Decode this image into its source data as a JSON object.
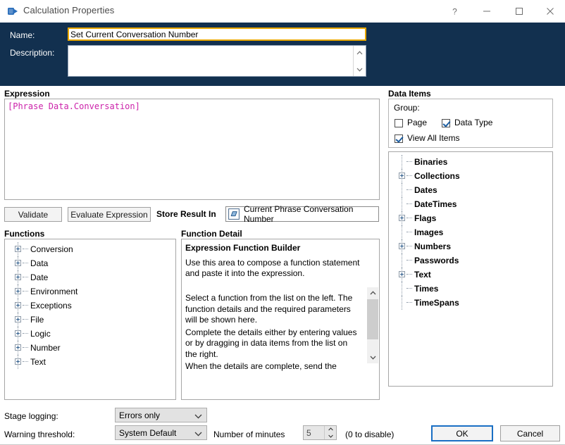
{
  "window": {
    "title": "Calculation Properties",
    "icon": "calculation-stage-icon",
    "controls": {
      "help": "?",
      "minimize": "—",
      "maximize": "□",
      "close": "✕"
    }
  },
  "header": {
    "name_label": "Name:",
    "name_value": "Set Current Conversation Number",
    "description_label": "Description:",
    "description_value": "",
    "accent_color": "#12304f",
    "name_focus_color": "#e8a600"
  },
  "expression": {
    "group_label": "Expression",
    "text": "[Phrase Data.Conversation]",
    "text_color": "#cc22aa"
  },
  "actions": {
    "validate": "Validate",
    "evaluate": "Evaluate Expression",
    "store_result_label": "Store Result In",
    "store_result_value": "Current Phrase Conversation Number",
    "store_result_icon": "number-data-item-icon"
  },
  "functions": {
    "group_label": "Functions",
    "items": [
      {
        "label": "Conversion",
        "expandable": true
      },
      {
        "label": "Data",
        "expandable": true
      },
      {
        "label": "Date",
        "expandable": true
      },
      {
        "label": "Environment",
        "expandable": true
      },
      {
        "label": "Exceptions",
        "expandable": true
      },
      {
        "label": "File",
        "expandable": true
      },
      {
        "label": "Logic",
        "expandable": true
      },
      {
        "label": "Number",
        "expandable": true
      },
      {
        "label": "Text",
        "expandable": true
      }
    ]
  },
  "function_detail": {
    "group_label": "Function Detail",
    "title": "Expression Function Builder",
    "intro": "Use this area to compose a function statement and paste it into the expression.",
    "paragraphs": [
      "Select a function from the list on the left. The function details and the required parameters will be shown here.",
      "Complete the details either by entering values or by dragging in data items from the list on the right.",
      "When the details are complete, send the"
    ]
  },
  "data_items": {
    "group_label": "Data Items",
    "group_by_label": "Group:",
    "checkboxes": [
      {
        "label": "Page",
        "checked": false
      },
      {
        "label": "Data Type",
        "checked": true
      },
      {
        "label": "View All Items",
        "checked": true
      }
    ],
    "items": [
      {
        "label": "Binaries",
        "expandable": false
      },
      {
        "label": "Collections",
        "expandable": true
      },
      {
        "label": "Dates",
        "expandable": false
      },
      {
        "label": "DateTimes",
        "expandable": false
      },
      {
        "label": "Flags",
        "expandable": true
      },
      {
        "label": "Images",
        "expandable": false
      },
      {
        "label": "Numbers",
        "expandable": true
      },
      {
        "label": "Passwords",
        "expandable": false
      },
      {
        "label": "Text",
        "expandable": true
      },
      {
        "label": "Times",
        "expandable": false
      },
      {
        "label": "TimeSpans",
        "expandable": false
      }
    ]
  },
  "footer": {
    "stage_logging_label": "Stage logging:",
    "stage_logging_value": "Errors only",
    "warning_threshold_label": "Warning threshold:",
    "warning_threshold_value": "System Default",
    "minutes_label": "Number of minutes",
    "minutes_value": "5",
    "disable_hint": "(0 to disable)",
    "ok": "OK",
    "cancel": "Cancel"
  }
}
